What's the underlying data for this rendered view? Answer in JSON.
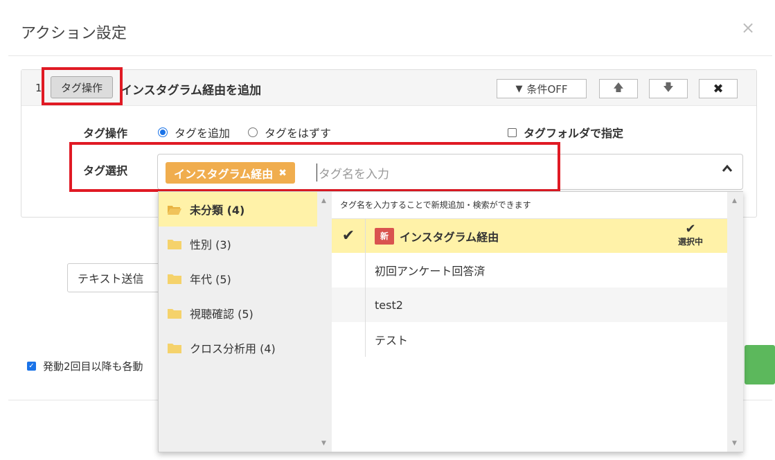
{
  "modal": {
    "title": "アクション設定",
    "close": "×"
  },
  "action": {
    "number": "1",
    "type_label": "タグ操作",
    "title": "インスタグラム経由を追加",
    "buttons": {
      "condition": "条件OFF",
      "up": "🡅",
      "down": "🡇",
      "delete": "✖"
    }
  },
  "form": {
    "operation_label": "タグ操作",
    "radio_add": "タグを追加",
    "radio_remove": "タグをはずす",
    "folder_check": "タグフォルダで指定",
    "select_label": "タグ選択",
    "chip": "インスタグラム経由",
    "chip_remove": "✖",
    "placeholder": "タグ名を入力",
    "chevron": "⌃"
  },
  "background": {
    "text_send_button": "テキスト送信",
    "repeat_checkbox": "発動2回目以降も各動"
  },
  "dropdown": {
    "hint": "タグ名を入力することで新規追加・検索ができます",
    "folders": [
      {
        "label": "未分類 (4)",
        "active": true
      },
      {
        "label": "性別 (3)",
        "active": false
      },
      {
        "label": "年代 (5)",
        "active": false
      },
      {
        "label": "視聴確認 (5)",
        "active": false
      },
      {
        "label": "クロス分析用 (4)",
        "active": false
      }
    ],
    "tags": [
      {
        "label": "インスタグラム経由",
        "new_badge": "新",
        "selected": true
      },
      {
        "label": "初回アンケート回答済"
      },
      {
        "label": "test2"
      },
      {
        "label": "テスト"
      }
    ],
    "selected_label": "選択中",
    "check_glyph": "✔"
  },
  "colors": {
    "highlight_red": "#e01a24",
    "chip_orange": "#f0ad4e",
    "active_yellow": "#fff2a8",
    "new_badge_red": "#d9534f",
    "radio_blue": "#1a73e8",
    "green": "#5cb85c"
  }
}
